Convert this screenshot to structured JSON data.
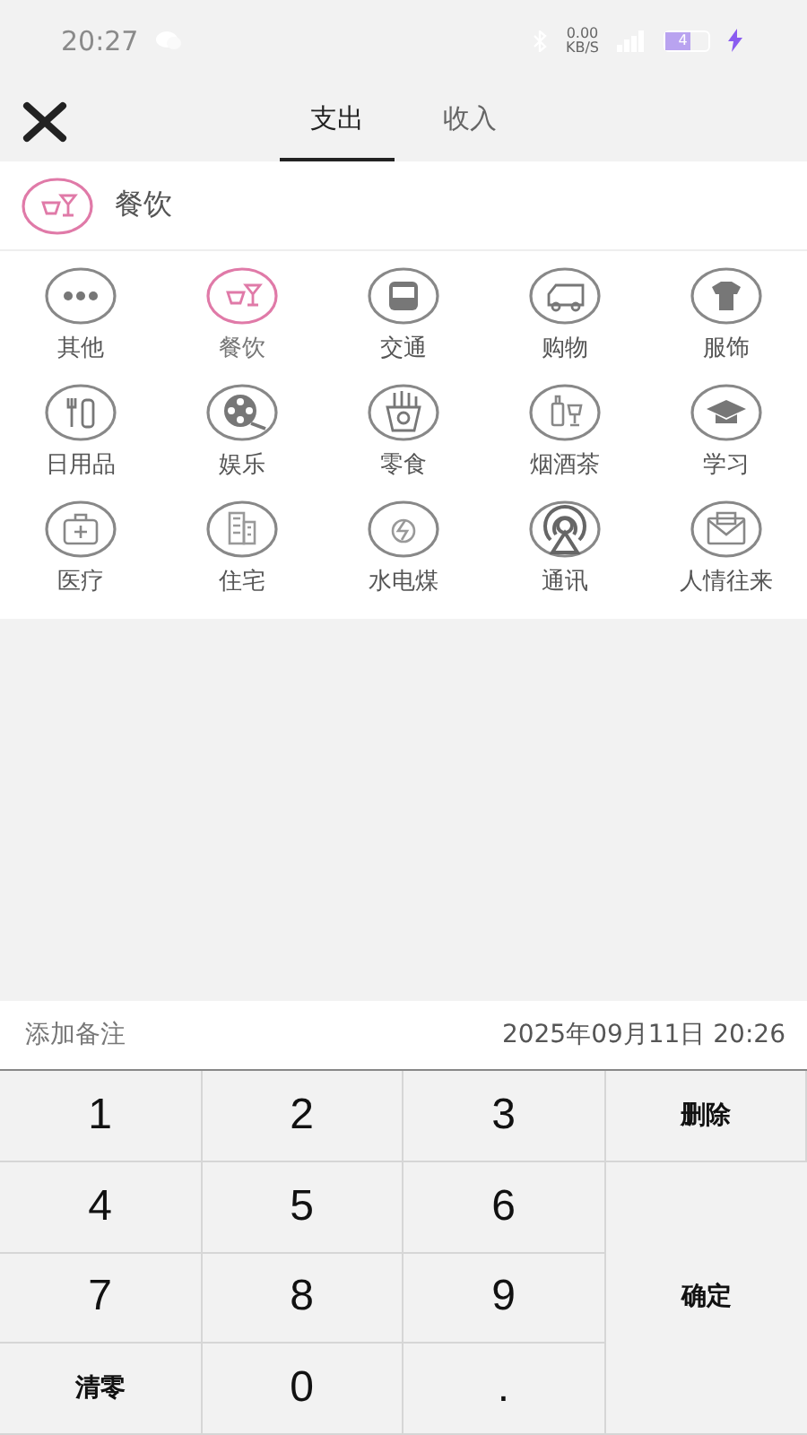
{
  "status_bar": {
    "time": "20:27",
    "speed_value": "0.00",
    "speed_unit": "KB/S",
    "battery": "4"
  },
  "header": {
    "tabs": [
      {
        "label": "支出",
        "selected": true
      },
      {
        "label": "收入",
        "selected": false
      }
    ]
  },
  "current_category": {
    "label": "餐饮",
    "kind": "dining"
  },
  "categories": [
    {
      "label": "其他",
      "kind": "dots",
      "selected": false
    },
    {
      "label": "餐饮",
      "kind": "dining",
      "selected": true
    },
    {
      "label": "交通",
      "kind": "bus",
      "selected": false
    },
    {
      "label": "购物",
      "kind": "truck",
      "selected": false
    },
    {
      "label": "服饰",
      "kind": "shirt",
      "selected": false
    },
    {
      "label": "日用品",
      "kind": "toiletries",
      "selected": false
    },
    {
      "label": "娱乐",
      "kind": "film",
      "selected": false
    },
    {
      "label": "零食",
      "kind": "fries",
      "selected": false
    },
    {
      "label": "烟酒茶",
      "kind": "bottle",
      "selected": false
    },
    {
      "label": "学习",
      "kind": "cap",
      "selected": false
    },
    {
      "label": "医疗",
      "kind": "medkit",
      "selected": false
    },
    {
      "label": "住宅",
      "kind": "building",
      "selected": false
    },
    {
      "label": "水电煤",
      "kind": "bolt",
      "selected": false
    },
    {
      "label": "通讯",
      "kind": "antenna",
      "selected": false
    },
    {
      "label": "人情往来",
      "kind": "envelope",
      "selected": false
    }
  ],
  "note_bar": {
    "placeholder": "添加备注",
    "datetime": "2025年09月11日 20:26"
  },
  "keypad": [
    {
      "label": "1",
      "kind": "digit"
    },
    {
      "label": "2",
      "kind": "digit"
    },
    {
      "label": "3",
      "kind": "digit"
    },
    {
      "label": "删除",
      "kind": "action"
    },
    {
      "label": "4",
      "kind": "digit"
    },
    {
      "label": "5",
      "kind": "digit"
    },
    {
      "label": "6",
      "kind": "digit"
    },
    {
      "label": "7",
      "kind": "digit"
    },
    {
      "label": "8",
      "kind": "digit"
    },
    {
      "label": "9",
      "kind": "digit"
    },
    {
      "label": "确定",
      "kind": "confirm"
    },
    {
      "label": "清零",
      "kind": "action"
    },
    {
      "label": "0",
      "kind": "digit"
    },
    {
      "label": ".",
      "kind": "digit"
    }
  ]
}
